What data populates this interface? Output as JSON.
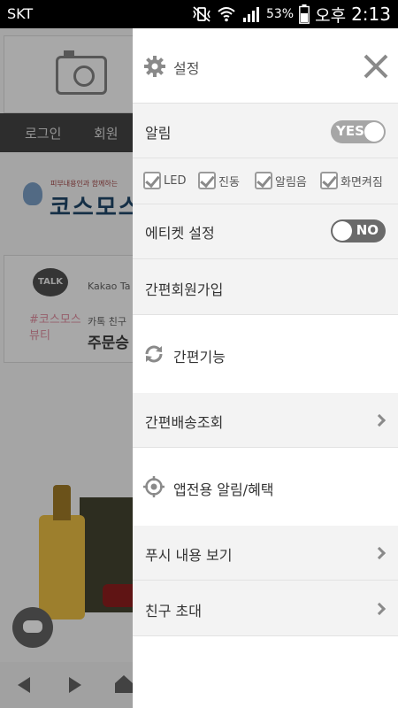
{
  "status_bar": {
    "carrier": "SKT",
    "battery_percent": "53%",
    "ampm": "오후",
    "time": "2:13"
  },
  "background": {
    "nav_items": [
      "로그인",
      "회원"
    ],
    "logo_tagline": "피부내용인과 함께하는",
    "logo_name": "코스모스",
    "kakao_bubble": "TALK",
    "kakao_text": "Kakao Ta",
    "kakao_pink": "#코스모스 뷰티",
    "kakao_small": "카톡 친구",
    "kakao_big": "주문승"
  },
  "drawer": {
    "settings_label": "설정",
    "alarm_label": "알림",
    "alarm_toggle": "YES",
    "alarm_options": [
      "LED",
      "진동",
      "알림음",
      "화면켜짐"
    ],
    "etiquette_label": "에티켓 설정",
    "etiquette_toggle": "NO",
    "signup_label": "간편회원가입",
    "quick_label": "간편기능",
    "delivery_label": "간편배송조회",
    "app_label": "앱전용 알림/혜택",
    "push_label": "푸시 내용 보기",
    "invite_label": "친구 초대"
  },
  "colors": {
    "drawer_bg": "#ffffff",
    "grey_row_bg": "#f3f3f3",
    "toggle_yes": "#a6a6a6",
    "toggle_no": "#6a6a6a",
    "icon_grey": "#8a8a8a"
  }
}
